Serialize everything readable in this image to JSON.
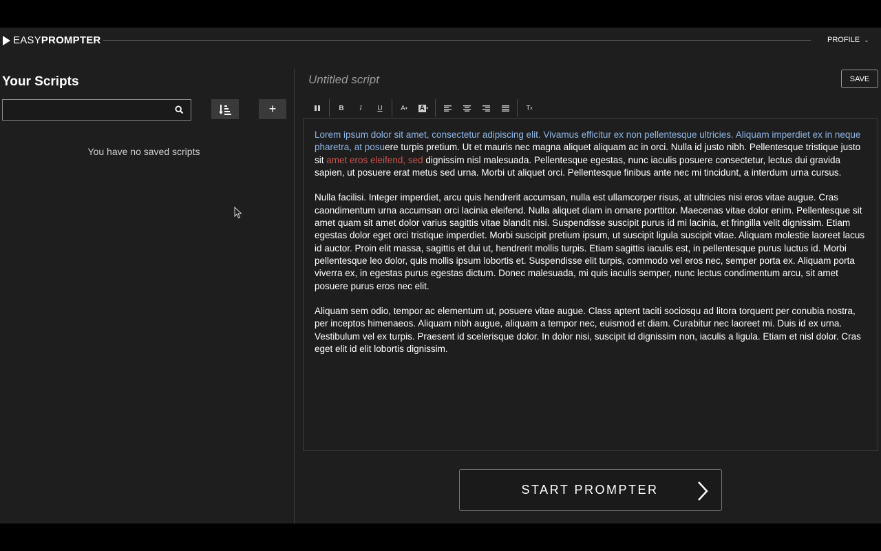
{
  "brand": {
    "easy": "EASY",
    "prompter": "PROMPTER"
  },
  "header": {
    "profile_label": "PROFILE"
  },
  "sidebar": {
    "title": "Your Scripts",
    "search_placeholder": "",
    "search_value": "",
    "sort_icon": "sort-icon",
    "add_label": "+",
    "empty_message": "You have no saved scripts"
  },
  "editor": {
    "title_placeholder": "Untitled script",
    "save_label": "SAVE",
    "toolbar": [
      "pause-icon",
      "bold-icon",
      "italic-icon",
      "underline-icon",
      "font-color-icon",
      "highlight-color-icon",
      "align-left-icon",
      "align-center-icon",
      "align-right-icon",
      "align-justify-icon",
      "clear-format-icon"
    ],
    "paragraphs": [
      {
        "selected": "Lorem ipsum dolor sit amet, consectetur adipiscing elit. Vivamus efficitur ex non pellentesque ultricies. Aliquam imperdiet ex in neque pharetra, at posu",
        "text1": "ere turpis pretium. Ut et mauris nec magna aliquet aliquam ac in orci. Nulla id justo nibh. Pellentesque tristique justo sit ",
        "red": "amet eros eleifend, sed",
        "text2": " dignissim nisl malesuada. Pellentesque egestas, nunc iaculis posuere consectetur, lectus dui gravida sapien, ut posuere erat metus sed urna. Morbi ut aliquet orci. Pellentesque finibus ante nec mi tincidunt, a interdum urna cursus."
      },
      {
        "text": "Nulla facilisi. Integer imperdiet, arcu quis hendrerit accumsan, nulla est ullamcorper risus, at ultricies nisi eros vitae augue. Cras caondimentum urna accumsan orci lacinia eleifend. Nulla aliquet diam in ornare porttitor. Maecenas vitae dolor enim. Pellentesque sit amet quam sit amet dolor varius sagittis vitae blandit nisi. Suspendisse suscipit purus id mi lacinia, et fringilla velit dignissim. Etiam egestas dolor eget orci tristique imperdiet. Morbi suscipit pretium ipsum, ut suscipit ligula suscipit vitae. Aliquam molestie laoreet lacus id auctor. Proin elit massa, sagittis et dui ut, hendrerit mollis turpis. Etiam sagittis iaculis est, in pellentesque purus luctus id. Morbi pellentesque leo dolor, quis mollis ipsum lobortis et. Suspendisse elit turpis, commodo vel eros nec, semper porta ex. Aliquam porta viverra ex, in egestas purus egestas dictum. Donec malesuada, mi quis iaculis semper, nunc lectus condimentum arcu, sit amet posuere purus eros nec elit."
      },
      {
        "text": "Aliquam sem odio, tempor ac elementum ut, posuere vitae augue. Class aptent taciti sociosqu ad litora torquent per conubia nostra, per inceptos himenaeos. Aliquam nibh augue, aliquam a tempor nec, euismod et diam. Curabitur nec laoreet mi. Duis id ex urna. Vestibulum vel ex turpis. Praesent id scelerisque dolor. In dolor nisi, suscipit id dignissim non, iaculis a ligula. Etiam et nisl dolor. Cras eget elit id elit lobortis dignissim."
      }
    ]
  },
  "start_button": {
    "label": "START PROMPTER"
  },
  "colors": {
    "background": "#1e1e1e",
    "selection_text": "#8fb6e6",
    "spellcheck_red": "#d0524d",
    "text": "#ffffff"
  }
}
